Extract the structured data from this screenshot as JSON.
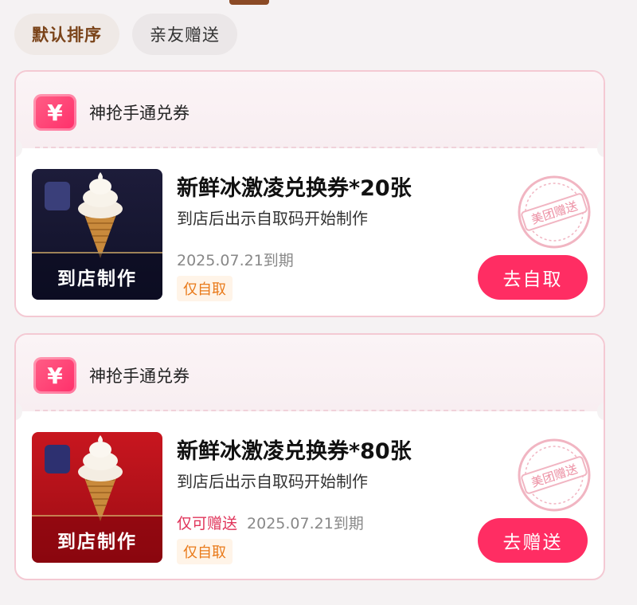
{
  "tabs": [
    {
      "label": "默认排序",
      "active": true
    },
    {
      "label": "亲友赠送",
      "active": false
    }
  ],
  "cards": [
    {
      "brand_badge_icon": "yen-icon",
      "brand_badge_text": "¥",
      "brand": "神抢手通兑券",
      "thumb_label": "到店制作",
      "thumb_theme": "navy",
      "title": "新鲜冰激凌兑换券*20张",
      "description": "到店后出示自取码开始制作",
      "gift_note": "",
      "expiry": "2025.07.21到期",
      "tag": "仅自取",
      "action": "去自取",
      "stamp": "美团赠送"
    },
    {
      "brand_badge_icon": "yen-icon",
      "brand_badge_text": "¥",
      "brand": "神抢手通兑券",
      "thumb_label": "到店制作",
      "thumb_theme": "red",
      "title": "新鲜冰激凌兑换券*80张",
      "description": "到店后出示自取码开始制作",
      "gift_note": "仅可赠送",
      "expiry": "2025.07.21到期",
      "tag": "仅自取",
      "action": "去赠送",
      "stamp": "美团赠送"
    }
  ],
  "colors": {
    "accent": "#ff2d63",
    "tab_active": "#7a4319",
    "tag_text": "#e97a1a"
  }
}
